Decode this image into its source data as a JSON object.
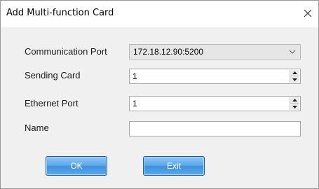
{
  "window": {
    "title": "Add Multi-function Card"
  },
  "form": {
    "communication_port": {
      "label": "Communication Port",
      "value": "172.18.12.90:5200"
    },
    "sending_card": {
      "label": "Sending Card",
      "value": "1"
    },
    "ethernet_port": {
      "label": "Ethernet Port",
      "value": "1"
    },
    "name": {
      "label": "Name",
      "value": ""
    }
  },
  "buttons": {
    "ok_label": "OK",
    "exit_label": "Exit"
  },
  "colors": {
    "button_blue": "#4f9de6",
    "dialog_background": "#f0f0f0",
    "combo_background": "#e6e6e6"
  },
  "icons": {
    "close": "close-icon",
    "dropdown": "chevron-down-icon",
    "spin_up": "triangle-up-icon",
    "spin_down": "triangle-down-icon"
  }
}
